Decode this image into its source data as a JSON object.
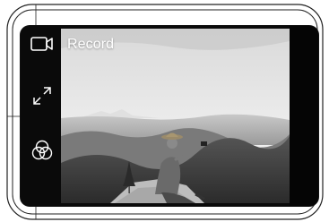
{
  "camera": {
    "record_label": "Record"
  },
  "controls": [
    {
      "name": "video-camera-icon",
      "action": "record"
    },
    {
      "name": "expand-icon",
      "action": "fullscreen"
    },
    {
      "name": "filters-icon",
      "action": "color-filters"
    }
  ],
  "colors": {
    "device_body": "#0a0a0a",
    "icon_stroke": "#ffffff",
    "label_text": "#ffffff"
  }
}
